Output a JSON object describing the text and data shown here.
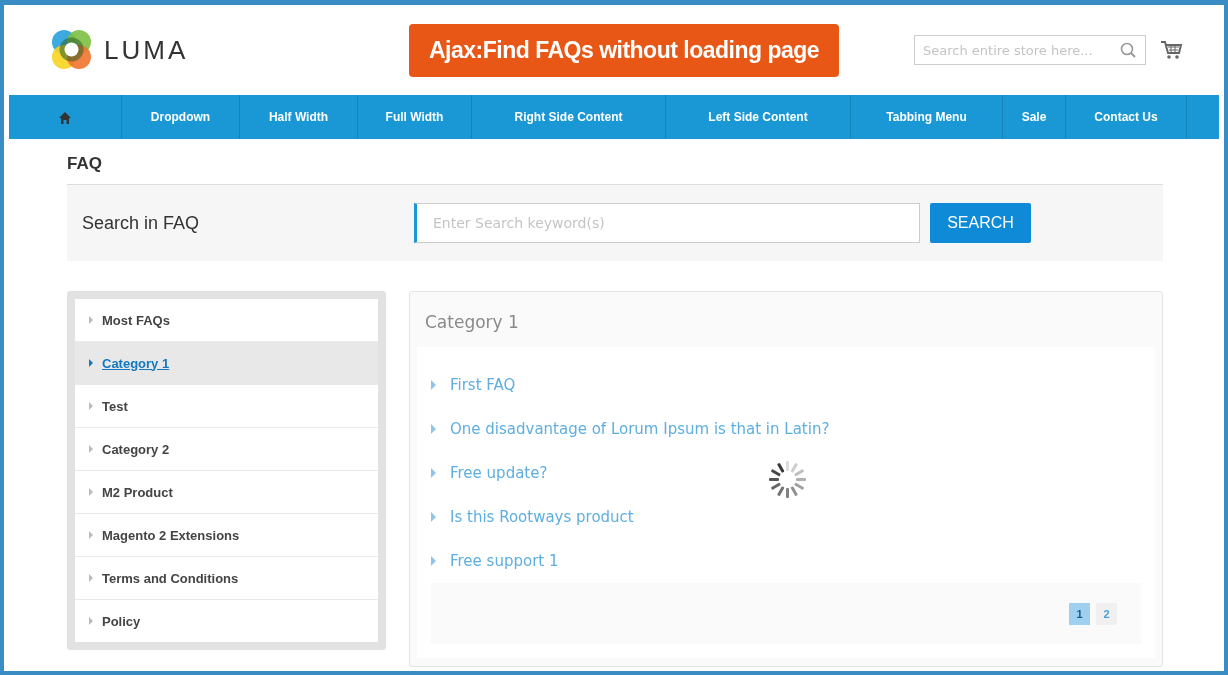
{
  "header": {
    "logo_text": "LUMA",
    "banner": "Ajax:Find FAQs without loading page",
    "search": {
      "placeholder": "Search entire store here..."
    }
  },
  "nav": [
    {
      "kind": "home"
    },
    {
      "kind": "link",
      "label": "Dropdown"
    },
    {
      "kind": "link",
      "label": "Half Width"
    },
    {
      "kind": "link",
      "label": "Full Width"
    },
    {
      "kind": "link",
      "label": "Right Side Content"
    },
    {
      "kind": "link",
      "label": "Left Side Content"
    },
    {
      "kind": "link",
      "label": "Tabbing Menu"
    },
    {
      "kind": "link",
      "label": "Sale"
    },
    {
      "kind": "link",
      "label": "Contact Us"
    }
  ],
  "page_title": "FAQ",
  "faq_search": {
    "label": "Search in FAQ",
    "placeholder": "Enter Search keyword(s)",
    "button": "SEARCH"
  },
  "categories": [
    {
      "label": "Most FAQs",
      "selected": false
    },
    {
      "label": "Category 1",
      "selected": true
    },
    {
      "label": "Test",
      "selected": false
    },
    {
      "label": "Category 2",
      "selected": false
    },
    {
      "label": "M2 Product",
      "selected": false
    },
    {
      "label": "Magento 2 Extensions",
      "selected": false
    },
    {
      "label": "Terms and Conditions",
      "selected": false
    },
    {
      "label": "Policy",
      "selected": false
    }
  ],
  "panel": {
    "title": "Category 1",
    "loading": true,
    "faqs": [
      "First FAQ",
      "One disadvantage of Lorum Ipsum is that in Latin?",
      "Free update?",
      "Is this Rootways product",
      "Free support 1"
    ],
    "pages": [
      {
        "label": "1",
        "selected": true
      },
      {
        "label": "2",
        "selected": false
      }
    ]
  }
}
